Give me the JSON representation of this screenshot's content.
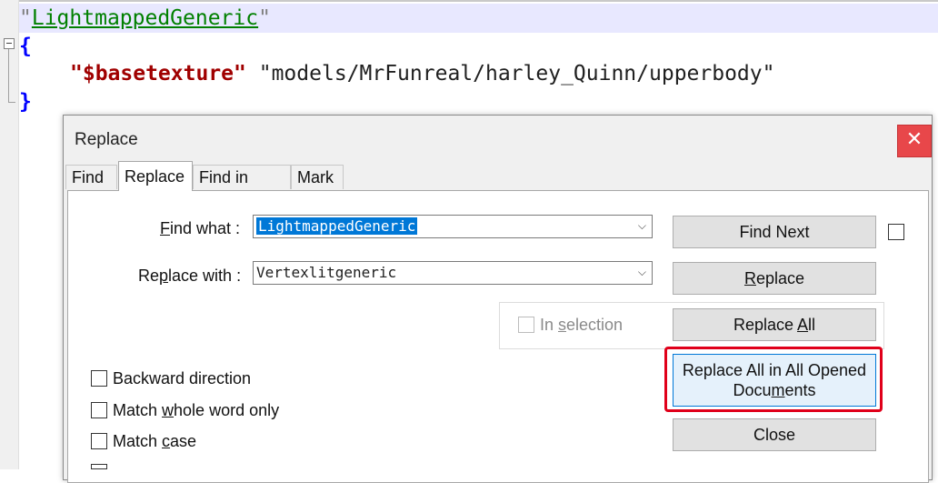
{
  "editor": {
    "line1_open_quote": "\"",
    "line1_text": "LightmappedGeneric",
    "line1_close_quote": "\"",
    "line2_text": "{",
    "line3_key": "\"$basetexture\"",
    "line3_value": "\"models/MrFunreal/harley_Quinn/upperbody\"",
    "line4_text": "}"
  },
  "dialog": {
    "title": "Replace",
    "close_glyph": "✕",
    "tabs": [
      {
        "label": "Find"
      },
      {
        "label": "Replace"
      },
      {
        "label": "Find in Files"
      },
      {
        "label": "Mark"
      }
    ],
    "find_what": {
      "label_pre": "",
      "label_underline": "F",
      "label_post": "ind what :",
      "value": "LightmappedGeneric"
    },
    "replace_with": {
      "label_pre": "Re",
      "label_underline": "p",
      "label_post": "lace with :",
      "value": "Vertexlitgeneric"
    },
    "in_selection": {
      "label_pre": "In ",
      "label_underline": "s",
      "label_post": "election"
    },
    "buttons": {
      "find_next": "Find Next",
      "replace_pre": "",
      "replace_underline": "R",
      "replace_post": "eplace",
      "replace_all_pre": "Replace ",
      "replace_all_underline": "A",
      "replace_all_post": "ll",
      "replace_all_opened_line1": "Replace All in All Opened",
      "replace_all_opened_line2_pre": "Docu",
      "replace_all_opened_line2_underline": "m",
      "replace_all_opened_line2_post": "ents",
      "close": "Close"
    },
    "options": {
      "backward_direction": "Backward direction",
      "match_whole_pre": "Match ",
      "match_whole_underline": "w",
      "match_whole_post": "hole word only",
      "match_case_pre": "Match ",
      "match_case_underline": "c",
      "match_case_post": "ase"
    }
  },
  "colors": {
    "selection": "#0078d7",
    "highlight_border": "#e0001a",
    "close_button": "#e8474a",
    "default_button_border": "#0078d7"
  }
}
